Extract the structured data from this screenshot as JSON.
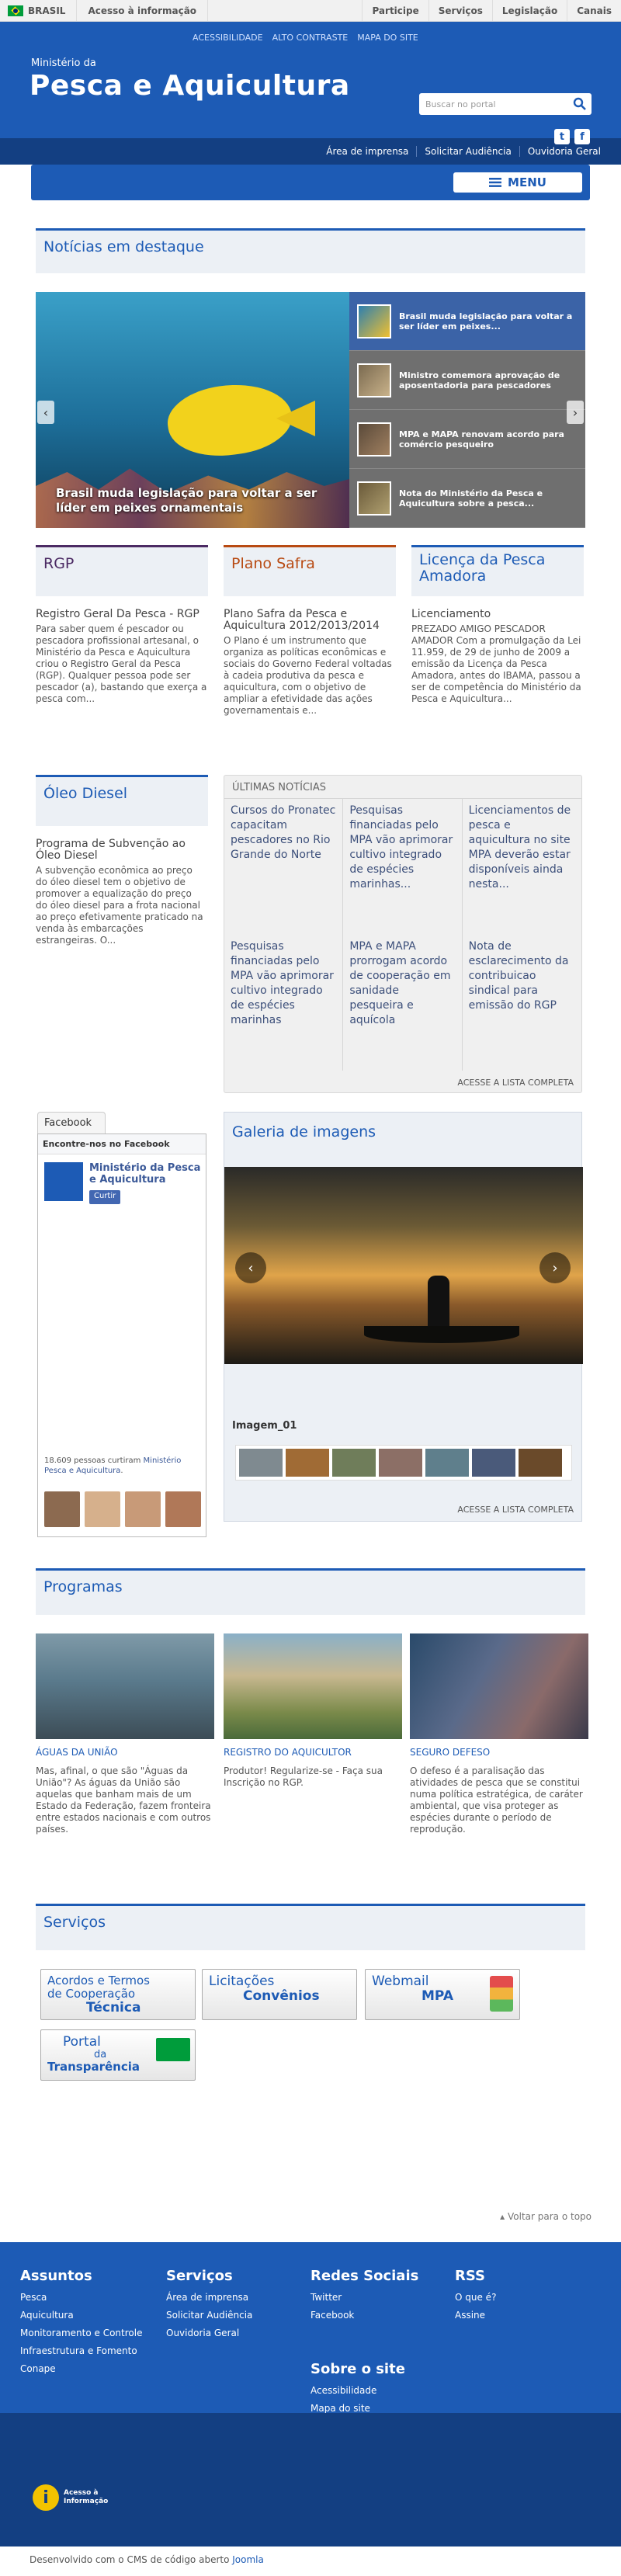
{
  "govbar": {
    "brasil": "BRASIL",
    "acesso": "Acesso à informação",
    "links": [
      "Participe",
      "Serviços",
      "Legislação",
      "Canais"
    ]
  },
  "accessibility": [
    "ACESSIBILIDADE",
    "ALTO CONTRASTE",
    "MAPA DO SITE"
  ],
  "header": {
    "ministerio": "Ministério da",
    "title": "Pesca e Aquicultura",
    "search_placeholder": "Buscar no portal",
    "social": [
      "twitter-icon",
      "facebook-icon"
    ]
  },
  "subnav": [
    "Área de imprensa",
    "Solicitar Audiência",
    "Ouvidoria Geral"
  ],
  "menu": {
    "label": "MENU"
  },
  "destaque": {
    "title": "Notícias em destaque",
    "caption": "Brasil muda legislação para voltar a ser líder em peixes ornamentais",
    "items": [
      "Brasil muda legislação para voltar a ser líder em peixes...",
      "Ministro comemora aprovação de aposentadoria para pescadores",
      "MPA e MAPA renovam acordo para comércio pesqueiro",
      "Nota do Ministério da Pesca e Aquicultura sobre a pesca..."
    ]
  },
  "cols": [
    {
      "title": "RGP",
      "color": "#4b2a63",
      "lead": "Registro Geral Da Pesca - RGP",
      "text": "Para saber quem é pescador ou pescadora profissional artesanal, o Ministério da Pesca e Aquicultura criou o Registro Geral da Pesca (RGP). Qualquer pessoa pode ser pescador (a), bastando que exerça a pesca com..."
    },
    {
      "title": "Plano Safra",
      "color": "#b84a12",
      "lead": "Plano Safra da Pesca e Aquicultura 2012/2013/2014",
      "text": "O Plano é um instrumento que organiza as políticas econômicas e sociais do Governo Federal voltadas à cadeia produtiva da pesca e aquicultura, com o objetivo de ampliar a efetividade das ações governamentais e..."
    },
    {
      "title": "Licença da Pesca Amadora",
      "color": "#1d5bb5",
      "lead": "Licenciamento",
      "text": "PREZADO AMIGO PESCADOR AMADOR Com a promulgação da Lei 11.959, de 29 de junho de 2009 a emissão da Licença da Pesca Amadora, antes do IBAMA, passou a ser de competência do Ministério da Pesca e Aquicultura..."
    }
  ],
  "oleo": {
    "title": "Óleo Diesel",
    "lead": "Programa de Subvenção ao Óleo Diesel",
    "text": "A subvenção econômica ao preço do óleo diesel tem o objetivo de promover a equalização do preço do óleo diesel para a frota nacional ao preço efetivamente praticado na venda às embarcações estrangeiras.  O..."
  },
  "ultimas": {
    "title": "ÚLTIMAS NOTÍCIAS",
    "items": [
      "Cursos do Pronatec capacitam pescadores no Rio Grande do Norte",
      "Pesquisas financiadas pelo MPA vão aprimorar cultivo integrado de espécies marinhas...",
      "Licenciamentos de pesca e aquicultura no site MPA deverão estar disponíveis ainda nesta...",
      "Pesquisas financiadas pelo MPA vão aprimorar cultivo integrado de espécies marinhas",
      "MPA e MAPA prorrogam acordo de cooperação em sanidade pesqueira e aquícola",
      "Nota de esclarecimento da contribuicao sindical para emissão do RGP"
    ],
    "more": "ACESSE A LISTA COMPLETA"
  },
  "facebook": {
    "tab": "Facebook",
    "header": "Encontre-nos no Facebook",
    "page_name": "Ministério da Pesca e Aquicultura",
    "like": "Curtir",
    "count_prefix": "18.609 pessoas curtiram ",
    "count_link": "Ministério Pesca e Aquicultura",
    "count_suffix": "."
  },
  "galeria": {
    "title": "Galeria de imagens",
    "caption": "Imagem_01",
    "more": "ACESSE A LISTA COMPLETA"
  },
  "programas": {
    "title": "Programas",
    "items": [
      {
        "title": "ÁGUAS DA UNIÃO",
        "text": "Mas, afinal, o que são \"Águas da União\"? As águas da União são aquelas que banham mais de um Estado da Federação, fazem fronteira entre estados nacionais e com outros países."
      },
      {
        "title": "REGISTRO DO AQUICULTOR",
        "text": "Produtor! Regularize-se - Faça sua Inscrição no RGP."
      },
      {
        "title": "SEGURO DEFESO",
        "text": "O defeso é a paralisação das atividades de pesca que se constitui numa política estratégica, de caráter ambiental, que visa proteger as espécies durante o período de reprodução."
      }
    ]
  },
  "servicos": {
    "title": "Serviços",
    "items": [
      {
        "l1": "Acordos e Termos de Cooperação",
        "l2": "Técnica"
      },
      {
        "l1": "Licitações",
        "l2": "Convênios"
      },
      {
        "l1": "Webmail",
        "l2": "MPA"
      },
      {
        "l1": "Portal",
        "l2": "da",
        "l3": "Transparência"
      }
    ]
  },
  "voltar": "Voltar para o topo",
  "footer": {
    "assuntos": {
      "title": "Assuntos",
      "items": [
        "Pesca",
        "Aquicultura",
        "Monitoramento e Controle",
        "Infraestrutura e Fomento",
        "Conape"
      ]
    },
    "servicos": {
      "title": "Serviços",
      "items": [
        "Área de imprensa",
        "Solicitar Audiência",
        "Ouvidoria Geral"
      ]
    },
    "redes": {
      "title": "Redes Sociais",
      "items": [
        "Twitter",
        "Facebook"
      ]
    },
    "rss": {
      "title": "RSS",
      "items": [
        "O que é?",
        "Assine"
      ]
    },
    "sobre": {
      "title": "Sobre o site",
      "items": [
        "Acessibilidade",
        "Mapa do site"
      ]
    },
    "acesso": [
      "Acesso à",
      "Informação"
    ]
  },
  "dev": {
    "prefix": "Desenvolvido com o CMS de código aberto ",
    "link": "Joomla"
  }
}
